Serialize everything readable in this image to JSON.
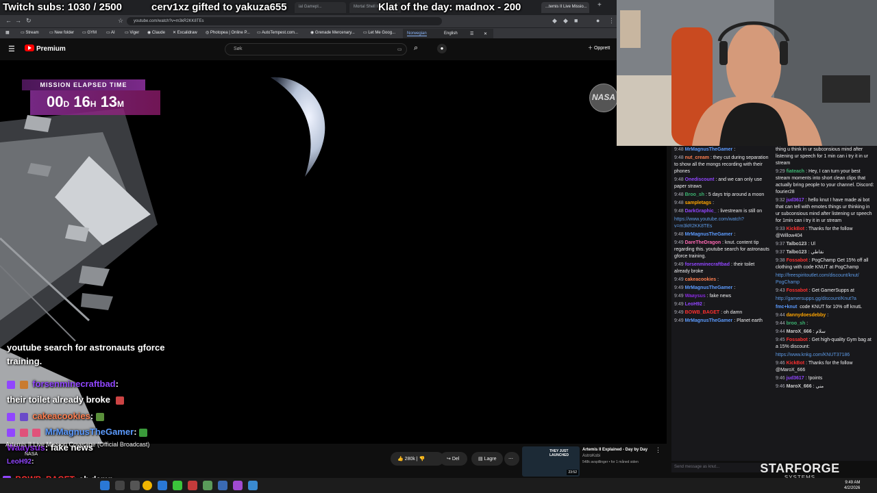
{
  "stream_overlay": {
    "subs_text": "Twitch subs: 1030 / 2500",
    "gift_text": "cerv1xz gifted to yakuza655",
    "klat_text": "Klat of the day: madnox - 200"
  },
  "browser": {
    "tabs": [
      "ial Gamepl...",
      "Mortal Shell II ...",
      "...temis II Live Missio..."
    ],
    "url": "youtube.com/watch?v=m3kR2KK8TEs",
    "bookmarks": [
      "Stream",
      "New folder",
      "GYM",
      "AI",
      "Viger",
      "Claude",
      "Excalidraw",
      "Photopea | Online P...",
      "AutoTempest.com...",
      "Grenade Mercenary...",
      "Let Me Goog..."
    ],
    "translate": {
      "from": "Norwegian",
      "to": "English"
    }
  },
  "youtube": {
    "brand": "Premium",
    "search_placeholder": "Søk",
    "create_label": "Opprett",
    "mission_label": "MISSION ELAPSED TIME",
    "clock": {
      "days": "00",
      "d_unit": "D",
      "hours": "16",
      "h_unit": "H",
      "minutes": "13",
      "m_unit": "M"
    },
    "nasa_label": "NASA",
    "video_title": "Artemis II Live Mission Coverage (Official Broadcast)",
    "channel": "NASA",
    "likes": "280k",
    "share_label": "Del",
    "save_label": "Lagre",
    "recommended": {
      "thumb_text": "THEY JUST LAUNCHED",
      "duration": "23:52",
      "title": "Artemis II Explained - Day by Day",
      "channel": "AstroKobi",
      "meta": "548k avspillinger • for 1 måned siden"
    }
  },
  "overlay_chat": [
    {
      "text": "youtube search for astronauts gforce",
      "color": "#ffffff"
    },
    {
      "text": "training.",
      "color": "#ffffff"
    },
    {
      "user": "forsenminecraftbad",
      "color": "#9146ff"
    },
    {
      "text": "their toilet already broke",
      "color": "#ffffff"
    },
    {
      "user": "cakeacookies",
      "color": "#ff7f50"
    },
    {
      "user": "MrMagnusTheGamer",
      "color": "#5c9bff"
    },
    {
      "user": "Waaysus",
      "text": "fake news",
      "color": "#8a2be2"
    },
    {
      "user": "LeoH92",
      "color": "#9146ff"
    },
    {
      "user": "BOWB_BAGET",
      "text": "oh damn",
      "color": "#ff3030"
    }
  ],
  "chat_left": [
    {
      "time": "9:48",
      "user": "MrMagnusTheGamer",
      "color": "#5c9bff",
      "text": ":"
    },
    {
      "time": "9:48",
      "user": "nut_cream",
      "color": "#ff7f50",
      "text": ": they cut during separation to show all the mongs recording with their phones"
    },
    {
      "time": "9:48",
      "user": "Onediscount",
      "color": "#9146ff",
      "text": ": and we can only use paper straws"
    },
    {
      "time": "9:48",
      "user": "Broo_sh",
      "color": "#3cb371",
      "text": ": 5 days trip around a moon"
    },
    {
      "time": "9:48",
      "user": "sampletags",
      "color": "#ffa500",
      "text": ":"
    },
    {
      "time": "9:48",
      "user": "DarkGraphic_",
      "color": "#9146ff",
      "text": ": livestream is still on"
    },
    {
      "link": "https://www.youtube.com/watch?v=m3kR2KK8TEs"
    },
    {
      "time": "9:48",
      "user": "MrMagnusTheGamer",
      "color": "#5c9bff",
      "text": ":"
    },
    {
      "time": "9:49",
      "user": "DareTheDragon",
      "color": "#ff69b4",
      "text": ": knut. content tip regarding this. youtube search for astronauts gforce training."
    },
    {
      "time": "9:49",
      "user": "forsenminecraftbad",
      "color": "#9146ff",
      "text": ": their toilet already broke"
    },
    {
      "time": "9:49",
      "user": "cakeacookies",
      "color": "#ff7f50",
      "text": ":"
    },
    {
      "time": "9:49",
      "user": "MrMagnusTheGamer",
      "color": "#5c9bff",
      "text": ":"
    },
    {
      "time": "9:49",
      "user": "Waaysus",
      "color": "#8a2be2",
      "text": ": fake news"
    },
    {
      "time": "9:49",
      "user": "LeoH92",
      "color": "#9146ff",
      "text": ":"
    },
    {
      "time": "9:49",
      "user": "BOWB_BAGET",
      "color": "#ff3030",
      "text": ": oh damn"
    },
    {
      "time": "9:49",
      "user": "MrMagnusTheGamer",
      "color": "#5c9bff",
      "text": ": Planet earth"
    }
  ],
  "chat_right": [
    {
      "text": "thing u think in ur subconsious mind after listening ur speech for 1 min can i try it in ur stream"
    },
    {
      "time": "9:29",
      "user": "fiateach",
      "color": "#3cb371",
      "text": ": Hey, I can turn your best stream moments into short clean clips that actually bring people to your channel. Discord: fourier28"
    },
    {
      "time": "9:32",
      "user": "jud3617",
      "color": "#9146ff",
      "text": ": hello knut I have made ai bot that can tell with emotes things ur thinking in ur subconsious mind after listening ur speech for 1min can i try it in ur stream"
    },
    {
      "time": "9:33",
      "user": "KickBot",
      "color": "#ff3030",
      "text": ": Thanks for the follow @Willow404"
    },
    {
      "time": "9:37",
      "user": "Talbo123",
      "color": "#cfcfcf",
      "text": ": Ul"
    },
    {
      "time": "9:37",
      "user": "Talbo123",
      "color": "#cfcfcf",
      "text": ": نقاطي"
    },
    {
      "time": "9:38",
      "user": "Fossabot",
      "color": "#ff3030",
      "text": ": PogChamp Get 15% off all clothing with code KNUT at PogChamp"
    },
    {
      "link": "http://freespiritoutlet.com/discount/knut/ PogChamp"
    },
    {
      "time": "9:43",
      "user": "Fossabot",
      "color": "#ff3030",
      "text": ": Get GamerSupps at"
    },
    {
      "link": "http://gamersupps.gg/discount/Knut?a"
    },
    {
      "user": "fmc+knut",
      "color": "#5c9bff",
      "text": " code KNUT for 10% off knutL"
    },
    {
      "time": "9:44",
      "user": "dannydoesdebby",
      "color": "#ffa500",
      "text": ":"
    },
    {
      "time": "9:44",
      "user": "broo_sh",
      "color": "#3cb371",
      "text": ":"
    },
    {
      "time": "9:44",
      "user": "MaroX_666",
      "color": "#cfcfcf",
      "text": ": سلام"
    },
    {
      "time": "9:45",
      "user": "Fossabot",
      "color": "#ff3030",
      "text": ": Get high-quality Gym bag at a 15% discount:"
    },
    {
      "link": "https://www.knkg.com/KNUT37186"
    },
    {
      "time": "9:46",
      "user": "KickBot",
      "color": "#ff3030",
      "text": ": Thanks for the follow @MaroX_666"
    },
    {
      "time": "9:46",
      "user": "jud3617",
      "color": "#9146ff",
      "text": ": !points"
    },
    {
      "time": "9:46",
      "user": "MaroX_666",
      "color": "#cfcfcf",
      "text": ": مني"
    }
  ],
  "chat_input_placeholder": "Send message as knut...",
  "brand": {
    "name": "STARFORGE",
    "sub": "SYSTEMS"
  },
  "taskbar": {
    "time": "9:49 AM",
    "date": "4/2/2026"
  }
}
